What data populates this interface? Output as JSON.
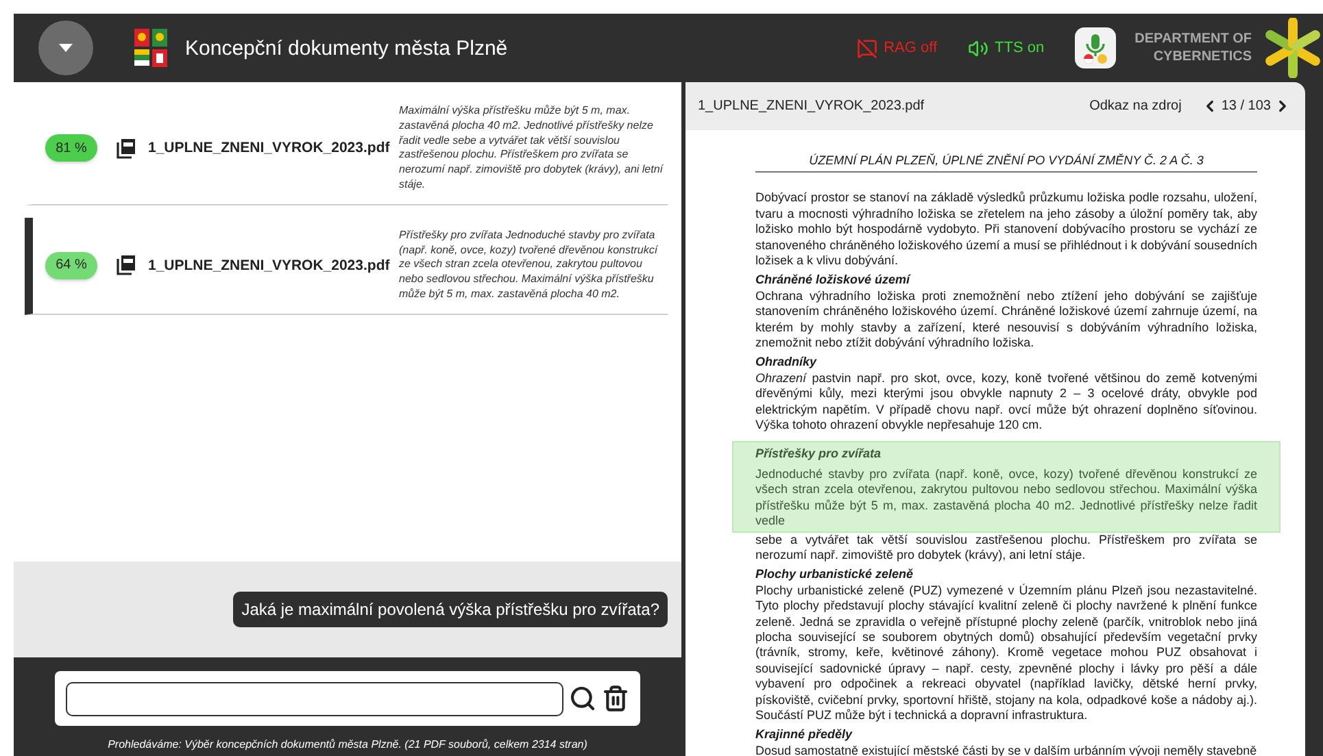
{
  "header": {
    "title": "Koncepční dokumenty města Plzně",
    "toggles": [
      {
        "kind": "rag",
        "label": "RAG off",
        "on": false
      },
      {
        "kind": "tts",
        "label": "TTS on",
        "on": true
      }
    ],
    "department": [
      "DEPARTMENT OF",
      "CYBERNETICS"
    ]
  },
  "results": [
    {
      "score": "81 %",
      "color": "#4ccd4c",
      "file": "1_UPLNE_ZNENI_VYROK_2023.pdf",
      "snippet": "Maximální výška přístřešku může být 5 m, max. zastavěná plocha 40 m2. Jednotlivé přístřešky nelze řadit vedle sebe a vytvářet tak větší souvislou zastřešenou plochu. Přístřeškem pro zvířata se nerozumí např. zimoviště pro dobytek (krávy), ani letní stáje.",
      "selected": false
    },
    {
      "score": "64 %",
      "color": "#74da74",
      "file": "1_UPLNE_ZNENI_VYROK_2023.pdf",
      "snippet": "Přístřešky pro zvířata Jednoduché stavby pro zvířata (např. koně, ovce, kozy) tvořené dřevěnou konstrukcí ze všech stran zcela otevřenou, zakrytou pultovou nebo sedlovou střechou. Maximální výška přístřešku může být 5 m, max. zastavěná plocha 40 m2.",
      "selected": true
    }
  ],
  "chat": {
    "messages": [
      "Jaká je maximální povolená výška přístřešku pro zvířata?"
    ]
  },
  "footer_note": "Prohledáváme: Výběr koncepčních dokumentů města Plzně. (21 PDF souborů, celkem 2314 stran)",
  "viewer": {
    "file": "1_UPLNE_ZNENI_VYROK_2023.pdf",
    "source_link": "Odkaz na zdroj",
    "page": "13 / 103",
    "document": {
      "title": "ÚZEMNÍ PLÁN PLZEŇ, ÚPLNÉ ZNĚNÍ PO VYDÁNÍ ZMĚNY Č. 2 A Č. 3",
      "blocks": [
        {
          "kind": "paragraph",
          "text": "Dobývací prostor se stanoví na základě výsledků průzkumu ložiska podle rozsahu, uložení, tvaru a mocnosti výhradního ložiska se zřetelem na jeho zásoby a úložní poměry tak, aby ložisko mohlo být hospodárně vydobyto. Při stanovení dobývacího prostoru se vychází ze stanoveného chráněného ložiskového území a musí se přihlédnout i k dobývání sousedních ložisek a k vlivu dobývání."
        },
        {
          "kind": "heading",
          "text": "Chráněné ložiskové území"
        },
        {
          "kind": "paragraph",
          "text": "Ochrana výhradního ložiska proti znemožnění nebo ztížení jeho dobývání se zajišťuje stanovením chráněného ložiskového území. Chráněné ložiskové území zahrnuje území, na kterém by mohly stavby a zařízení, které nesouvisí s dobýváním výhradního ložiska, znemožnit nebo ztížit dobývání výhradního ložiska."
        },
        {
          "kind": "heading",
          "text": "Ohradníky"
        },
        {
          "kind": "paragraph",
          "text": "*Ohrazení* pastvin např. pro skot, ovce, kozy, koně tvořené většinou do země kotvenými dřevěnými kůly, mezi kterými jsou obvykle napnuty 2 – 3 ocelové dráty, obvykle pod elektrickým napětím. V případě chovu např. ovcí může být ohrazení doplněno síťovinou. Výška tohoto ohrazení obvykle nepřesahuje 120 cm."
        },
        {
          "kind": "highlight",
          "heading": "Přístřešky pro zvířata",
          "text": "Jednoduché stavby pro zvířata (např. koně, ovce, kozy) tvořené dřevěnou konstrukcí ze všech stran zcela otevřenou, zakrytou pultovou nebo sedlovou střechou. Maximální výška přístřešku může být 5 m, max. zastavěná plocha 40 m2. Jednotlivé přístřešky nelze řadit vedle"
        },
        {
          "kind": "continuation",
          "text": "sebe a vytvářet tak větší souvislou zastřešenou plochu. Přístřeškem pro zvířata se nerozumí např. zimoviště pro dobytek (krávy), ani letní stáje."
        },
        {
          "kind": "heading",
          "text": "Plochy urbanistické zeleně"
        },
        {
          "kind": "paragraph",
          "text": "Plochy urbanistické zeleně (PUZ) vymezené v Územním plánu Plzeň jsou nezastavitelné. Tyto plochy představují plochy stávající kvalitní zeleně či plochy navržené k plnění funkce zeleně. Jedná se zpravidla o veřejně přístupné plochy zeleně (parčík, vnitroblok nebo jiná plocha související se souborem obytných domů) obsahující především vegetační prvky (trávník, stromy, keře, květinové záhony). Kromě vegetace mohou PUZ obsahovat i související sadovnické úpravy – např. cesty, zpevněné plochy i lávky pro pěší a dále vybavení pro odpočinek a rekreaci obyvatel (například lavičky, dětské herní prvky, pískoviště, cvičební prvky, sportovní hřiště, stojany na kola, odpadkové koše a nádoby aj.). Součástí PUZ může být i technická a dopravní infrastruktura."
        },
        {
          "kind": "heading",
          "text": "Krajinné předěly"
        },
        {
          "kind": "paragraph",
          "text": "Dosud samostatně existující městské části by se v dalším urbánním vývoji neměly stavebně"
        }
      ]
    }
  }
}
